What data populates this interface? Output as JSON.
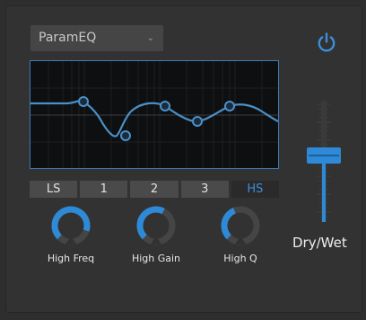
{
  "preset": {
    "selected": "ParamEQ",
    "chevron_icon": "chevron-down-icon"
  },
  "power": {
    "icon": "power-icon",
    "color": "#3b8fd9"
  },
  "eq": {
    "curve_color": "#4a90c8",
    "border_color": "#3d7ab8",
    "background": "#0e0f10"
  },
  "bands": [
    {
      "label": "LS",
      "active": false
    },
    {
      "label": "1",
      "active": false
    },
    {
      "label": "2",
      "active": false
    },
    {
      "label": "3",
      "active": false
    },
    {
      "label": "HS",
      "active": true
    }
  ],
  "knobs": [
    {
      "label": "High Freq",
      "value": 0.9
    },
    {
      "label": "High Gain",
      "value": 0.6
    },
    {
      "label": "High Q",
      "value": 0.42
    }
  ],
  "mix": {
    "label": "Dry/Wet",
    "value": 0.55
  },
  "accent_color": "#2e8ad6"
}
